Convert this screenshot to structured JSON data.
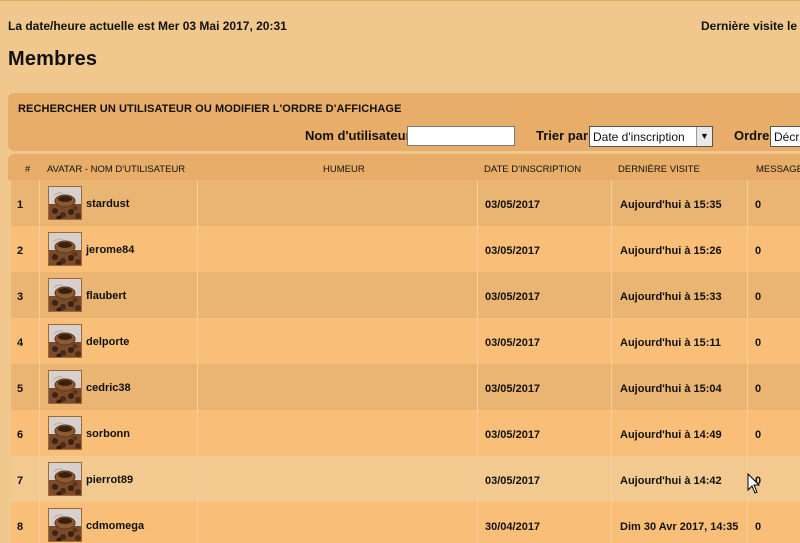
{
  "header": {
    "datetime_text": "La date/heure actuelle est Mer 03 Mai 2017, 20:31",
    "last_visit_text": "Dernière visite le M"
  },
  "page": {
    "title": "Membres"
  },
  "search": {
    "heading": "RECHERCHER UN UTILISATEUR OU MODIFIER L'ORDRE D'AFFICHAGE",
    "username_label": "Nom d'utilisateur",
    "username_value": "",
    "sort_label": "Trier par",
    "sort_value": "Date d'inscription",
    "order_label": "Ordre",
    "order_value": "Décr"
  },
  "table": {
    "headers": {
      "rank": "#",
      "avatar_username": "AVATAR - NOM D'UTILISATEUR",
      "mood": "HUMEUR",
      "signup_date": "DATE D'INSCRIPTION",
      "last_visit": "DERNIÈRE VISITE",
      "messages": "MESSAGE"
    },
    "rows": [
      {
        "rank": "1",
        "username": "stardust",
        "signup": "03/05/2017",
        "last_visit": "Aujourd'hui à 15:35",
        "messages": "0"
      },
      {
        "rank": "2",
        "username": "jerome84",
        "signup": "03/05/2017",
        "last_visit": "Aujourd'hui à 15:26",
        "messages": "0"
      },
      {
        "rank": "3",
        "username": "flaubert",
        "signup": "03/05/2017",
        "last_visit": "Aujourd'hui à 15:33",
        "messages": "0"
      },
      {
        "rank": "4",
        "username": "delporte",
        "signup": "03/05/2017",
        "last_visit": "Aujourd'hui à 15:11",
        "messages": "0"
      },
      {
        "rank": "5",
        "username": "cedric38",
        "signup": "03/05/2017",
        "last_visit": "Aujourd'hui à 15:04",
        "messages": "0"
      },
      {
        "rank": "6",
        "username": "sorbonn",
        "signup": "03/05/2017",
        "last_visit": "Aujourd'hui à 14:49",
        "messages": "0"
      },
      {
        "rank": "7",
        "username": "pierrot89",
        "signup": "03/05/2017",
        "last_visit": "Aujourd'hui à 14:42",
        "messages": "0"
      },
      {
        "rank": "8",
        "username": "cdmomega",
        "signup": "30/04/2017",
        "last_visit": "Dim 30 Avr 2017, 14:35",
        "messages": "0"
      }
    ]
  }
}
